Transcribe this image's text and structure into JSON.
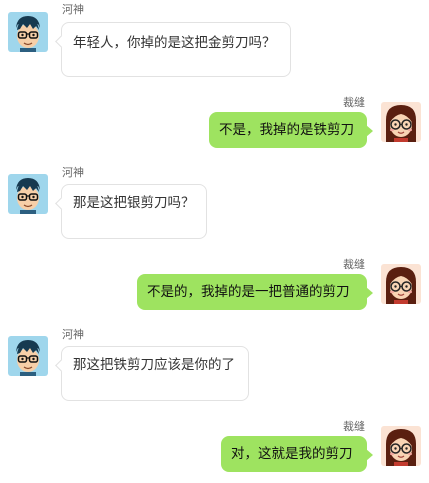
{
  "contacts": {
    "river_god": "河神",
    "tailor": "裁缝"
  },
  "messages": [
    {
      "from": "河神",
      "side": "left",
      "text": "年轻人，你掉的是这把金剪刀吗？"
    },
    {
      "from": "裁缝",
      "side": "right",
      "text": "不是，我掉的是铁剪刀"
    },
    {
      "from": "河神",
      "side": "left",
      "text": "那是这把银剪刀吗？"
    },
    {
      "from": "裁缝",
      "side": "right",
      "text": "不是的，我掉的是一把普通的剪刀"
    },
    {
      "from": "河神",
      "side": "left",
      "text": "那这把铁剪刀应该是你的了"
    },
    {
      "from": "裁缝",
      "side": "right",
      "text": "对，这就是我的剪刀"
    }
  ],
  "icons": {
    "left_avatar": "boy-with-glasses-avatar-icon",
    "right_avatar": "girl-with-glasses-avatar-icon"
  },
  "colors": {
    "left_bubble": "#ffffff",
    "left_border": "#e2e2e2",
    "right_bubble": "#9ee360",
    "sender_text": "#666666"
  }
}
